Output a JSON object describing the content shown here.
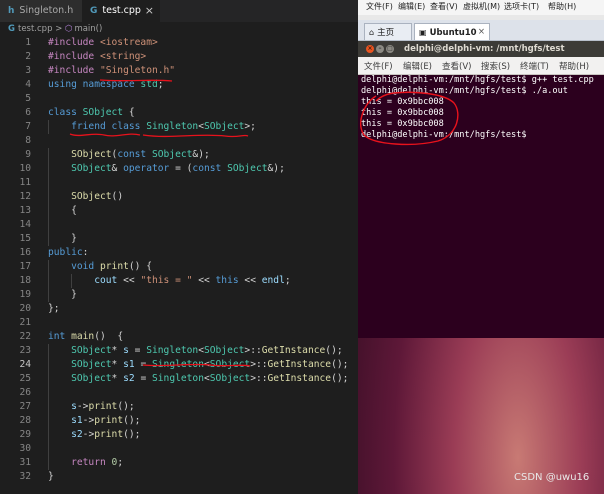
{
  "editor": {
    "tabs": [
      {
        "icon": "h",
        "label": "Singleton.h"
      },
      {
        "icon": "G",
        "label": "test.cpp",
        "close": "×"
      }
    ],
    "breadcrumb": {
      "icon": "G",
      "file": "test.cpp",
      "sep": ">",
      "symbol_icon": "⬡",
      "symbol": "main()"
    },
    "lines": [
      {
        "n": "1",
        "toks": [
          [
            "pp",
            "#include "
          ],
          [
            "str",
            "<iostream>"
          ]
        ]
      },
      {
        "n": "2",
        "toks": [
          [
            "pp",
            "#include "
          ],
          [
            "str",
            "<string>"
          ]
        ]
      },
      {
        "n": "3",
        "toks": [
          [
            "pp",
            "#include "
          ],
          [
            "str",
            "\"Singleton.h\""
          ]
        ]
      },
      {
        "n": "4",
        "toks": [
          [
            "kw",
            "using "
          ],
          [
            "kw",
            "namespace "
          ],
          [
            "ty",
            "std"
          ],
          [
            "",
            "; "
          ]
        ]
      },
      {
        "n": "5",
        "toks": []
      },
      {
        "n": "6",
        "toks": [
          [
            "kw",
            "class "
          ],
          [
            "ty",
            "SObject"
          ],
          [
            "",
            " {"
          ]
        ]
      },
      {
        "n": "7",
        "toks": [
          [
            "",
            "    "
          ],
          [
            "kw",
            "friend "
          ],
          [
            "kw",
            "class "
          ],
          [
            "ty",
            "Singleton"
          ],
          [
            "",
            "<"
          ],
          [
            "ty",
            "SObject"
          ],
          [
            "",
            ">;"
          ]
        ]
      },
      {
        "n": "8",
        "toks": []
      },
      {
        "n": "9",
        "toks": [
          [
            "",
            "    "
          ],
          [
            "fn",
            "SObject"
          ],
          [
            "",
            "("
          ],
          [
            "kw",
            "const "
          ],
          [
            "ty",
            "SObject"
          ],
          [
            "",
            "&);"
          ]
        ]
      },
      {
        "n": "10",
        "toks": [
          [
            "",
            "    "
          ],
          [
            "ty",
            "SObject"
          ],
          [
            "",
            "& "
          ],
          [
            "kw",
            "operator "
          ],
          [
            "",
            "= ("
          ],
          [
            "kw",
            "const "
          ],
          [
            "ty",
            "SObject"
          ],
          [
            "",
            "&);"
          ]
        ]
      },
      {
        "n": "11",
        "toks": []
      },
      {
        "n": "12",
        "toks": [
          [
            "",
            "    "
          ],
          [
            "fn",
            "SObject"
          ],
          [
            "",
            "()"
          ]
        ]
      },
      {
        "n": "13",
        "toks": [
          [
            "",
            "    {"
          ]
        ]
      },
      {
        "n": "14",
        "toks": []
      },
      {
        "n": "15",
        "toks": [
          [
            "",
            "    }"
          ]
        ]
      },
      {
        "n": "16",
        "toks": [
          [
            "kw",
            "public"
          ],
          [
            "",
            ":"
          ]
        ]
      },
      {
        "n": "17",
        "toks": [
          [
            "",
            "    "
          ],
          [
            "kw",
            "void "
          ],
          [
            "fn",
            "print"
          ],
          [
            "",
            "() {"
          ]
        ]
      },
      {
        "n": "18",
        "toks": [
          [
            "",
            "        "
          ],
          [
            "var",
            "cout"
          ],
          [
            "",
            " << "
          ],
          [
            "str",
            "\"this = \""
          ],
          [
            "",
            " << "
          ],
          [
            "kw",
            "this"
          ],
          [
            "",
            " << "
          ],
          [
            "var",
            "endl"
          ],
          [
            "",
            ";"
          ]
        ]
      },
      {
        "n": "19",
        "toks": [
          [
            "",
            "    }"
          ]
        ]
      },
      {
        "n": "20",
        "toks": [
          [
            "",
            "};"
          ]
        ]
      },
      {
        "n": "21",
        "toks": []
      },
      {
        "n": "22",
        "toks": [
          [
            "kw",
            "int "
          ],
          [
            "fn",
            "main"
          ],
          [
            "",
            "()  {"
          ]
        ]
      },
      {
        "n": "23",
        "toks": [
          [
            "",
            "    "
          ],
          [
            "ty",
            "SObject"
          ],
          [
            "",
            "* "
          ],
          [
            "var",
            "s"
          ],
          [
            "",
            " = "
          ],
          [
            "ty",
            "Singleton"
          ],
          [
            "",
            "<"
          ],
          [
            "ty",
            "SObject"
          ],
          [
            "",
            ">::"
          ],
          [
            "fn",
            "GetInstance"
          ],
          [
            "",
            "();"
          ]
        ]
      },
      {
        "n": "24",
        "toks": [
          [
            "",
            "    "
          ],
          [
            "ty",
            "SObject"
          ],
          [
            "",
            "* "
          ],
          [
            "var",
            "s1"
          ],
          [
            "",
            " = "
          ],
          [
            "ty",
            "Singleton"
          ],
          [
            "",
            "<"
          ],
          [
            "ty",
            "SObject"
          ],
          [
            "",
            ">::"
          ],
          [
            "fn",
            "GetInstance"
          ],
          [
            "",
            "();"
          ]
        ]
      },
      {
        "n": "25",
        "toks": [
          [
            "",
            "    "
          ],
          [
            "ty",
            "SObject"
          ],
          [
            "",
            "* "
          ],
          [
            "var",
            "s2"
          ],
          [
            "",
            " = "
          ],
          [
            "ty",
            "Singleton"
          ],
          [
            "",
            "<"
          ],
          [
            "ty",
            "SObject"
          ],
          [
            "",
            ">::"
          ],
          [
            "fn",
            "GetInstance"
          ],
          [
            "",
            "();"
          ]
        ]
      },
      {
        "n": "26",
        "toks": []
      },
      {
        "n": "27",
        "toks": [
          [
            "",
            "    "
          ],
          [
            "var",
            "s"
          ],
          [
            "",
            "->"
          ],
          [
            "fn",
            "print"
          ],
          [
            "",
            "();"
          ]
        ]
      },
      {
        "n": "28",
        "toks": [
          [
            "",
            "    "
          ],
          [
            "var",
            "s1"
          ],
          [
            "",
            "->"
          ],
          [
            "fn",
            "print"
          ],
          [
            "",
            "();"
          ]
        ]
      },
      {
        "n": "29",
        "toks": [
          [
            "",
            "    "
          ],
          [
            "var",
            "s2"
          ],
          [
            "",
            "->"
          ],
          [
            "fn",
            "print"
          ],
          [
            "",
            "();"
          ]
        ]
      },
      {
        "n": "30",
        "toks": []
      },
      {
        "n": "31",
        "toks": [
          [
            "",
            "    "
          ],
          [
            "kw2",
            "return "
          ],
          [
            "num",
            "0"
          ],
          [
            "",
            ";"
          ]
        ]
      },
      {
        "n": "32",
        "toks": [
          [
            "",
            "}"
          ]
        ]
      }
    ],
    "current_line": "24"
  },
  "vm": {
    "menu": [
      "文件(F)",
      "编辑(E)",
      "查看(V)",
      "虚拟机(M)",
      "选项卡(T)",
      "帮助(H)"
    ],
    "tabs": [
      {
        "icon": "⌂",
        "label": "主页"
      },
      {
        "icon": "▣",
        "label": "Ubuntu10",
        "close": "×"
      }
    ],
    "window_title": "delphi@delphi-vm: /mnt/hgfs/test",
    "window_buttons": {
      "close": "×",
      "min": "–",
      "max": "□"
    },
    "terminal_menu": [
      "文件(F)",
      "编辑(E)",
      "查看(V)",
      "搜索(S)",
      "终端(T)",
      "帮助(H)"
    ],
    "terminal_lines": [
      "delphi@delphi-vm:/mnt/hgfs/test$ g++ test.cpp",
      "delphi@delphi-vm:/mnt/hgfs/test$ ./a.out",
      "this = 0x9bbc008",
      "this = 0x9bbc008",
      "this = 0x9bbc008",
      "delphi@delphi-vm:/mnt/hgfs/test$"
    ]
  },
  "watermark": "CSDN @uwu16",
  "colors": {
    "annotation": "#e8121c",
    "editor_bg": "#1e1e1e",
    "terminal_bg": "#2c001e"
  }
}
